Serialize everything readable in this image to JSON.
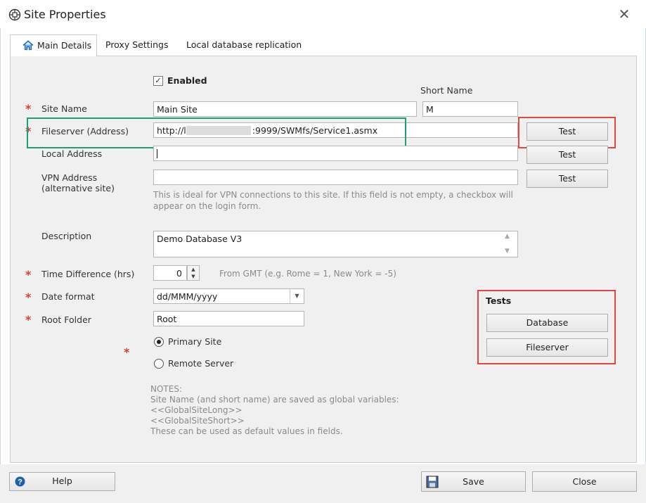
{
  "window": {
    "title": "Site Properties",
    "close_symbol": "✕"
  },
  "tabs": [
    {
      "label": "Main Details"
    },
    {
      "label": "Proxy Settings"
    },
    {
      "label": "Local database replication"
    }
  ],
  "form": {
    "enabled": {
      "label": "Enabled",
      "checked": true
    },
    "short_name": {
      "label": "Short Name",
      "value": "M"
    },
    "site_name": {
      "label": "Site Name",
      "value": "Main Site"
    },
    "fileserver": {
      "label": "Fileserver (Address)",
      "value_prefix": "http://l",
      "value_suffix": ":9999/SWMfs/Service1.asmx",
      "test_label": "Test"
    },
    "local_address": {
      "label": "Local Address",
      "value": "",
      "test_label": "Test"
    },
    "vpn_address": {
      "label_line1": "VPN Address",
      "label_line2": "(alternative site)",
      "value": "",
      "test_label": "Test",
      "hint_line1": "This is ideal for VPN connections to this site. If this field is not empty,  a checkbox will",
      "hint_line2": "appear on the login form."
    },
    "description": {
      "label": "Description",
      "value": "Demo Database V3"
    },
    "time_difference": {
      "label": "Time Difference (hrs)",
      "value": "0",
      "hint": "From GMT (e.g. Rome = 1, New York = -5)"
    },
    "date_format": {
      "label": "Date format",
      "value": "dd/MMM/yyyy"
    },
    "root_folder": {
      "label": "Root Folder",
      "value": "Root"
    },
    "site_type": {
      "options": [
        {
          "label": "Primary Site",
          "selected": true
        },
        {
          "label": "Remote Server",
          "selected": false
        }
      ]
    },
    "notes": [
      "NOTES:",
      "Site Name (and short name) are saved as global variables:",
      "<<GlobalSiteLong>>",
      "<<GlobalSiteShort>>",
      "These can be used as default values in fields."
    ]
  },
  "tests": {
    "title": "Tests",
    "database_label": "Database",
    "fileserver_label": "Fileserver"
  },
  "footer": {
    "help_label": "Help",
    "save_label": "Save",
    "close_label": "Close"
  },
  "colors": {
    "required_star": "#e53935",
    "highlight_red": "#e04848",
    "highlight_green": "#1f9e7a",
    "help_icon": "#1d5fa8"
  }
}
